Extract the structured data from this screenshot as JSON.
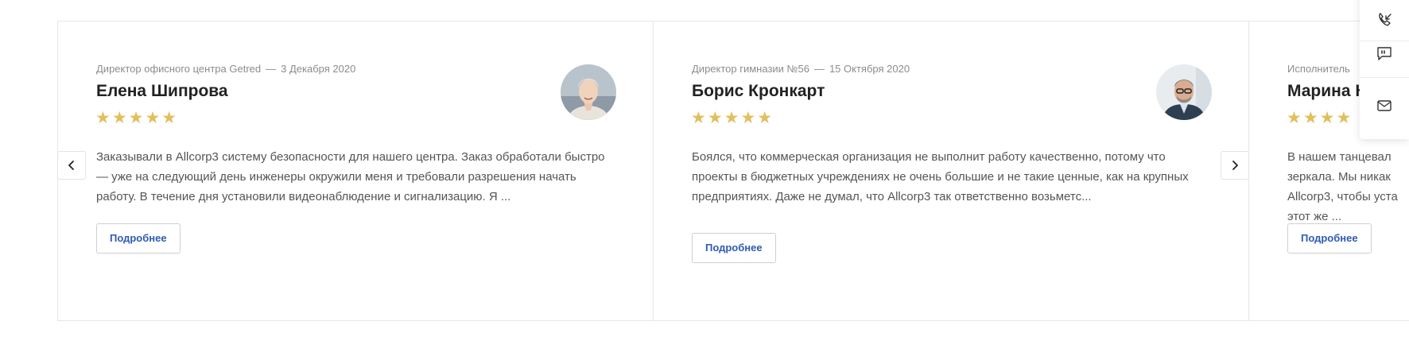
{
  "colors": {
    "star": "#e2bf5d",
    "button_text": "#2f5bb3",
    "meta_text": "#8c8c8c",
    "card_border": "#e6e6e6"
  },
  "slider": {
    "prev_icon": "chevron-left-icon",
    "next_icon": "chevron-right-icon"
  },
  "reviews": [
    {
      "position": "Директор офисного центра Getred",
      "date": "3 Декабря 2020",
      "separator": "—",
      "name": "Елена Шипрова",
      "stars": "★★★★★",
      "rating": 5,
      "text": "Заказывали в Allcorp3 систему безопасности для нашего центра. Заказ обработали быстро — уже на следующий день инженеры окружили меня и требовали разрешения начать работу. В течение дня установили видеонаблюдение и сигнализацию. Я ...",
      "button": "Подробнее"
    },
    {
      "position": "Директор гимназии №56",
      "date": "15 Октября 2020",
      "separator": "—",
      "name": "Борис Кронкарт",
      "stars": "★★★★★",
      "rating": 5,
      "text": "Боялся, что коммерческая организация не выполнит работу качественно, потому что проекты в бюджетных учреждениях не очень большие и не такие ценные, как на крупных предприятиях. Даже не думал, что Allcorp3 так ответственно возьметс...",
      "button": "Подробнее"
    },
    {
      "position": "Исполнитель",
      "date": "",
      "separator": "",
      "name": "Марина К",
      "stars": "★★★★",
      "rating": 4,
      "text": "В нашем танцевал зеркала. Мы никак Allcorp3, чтобы уста этот же ...",
      "button": "Подробнее"
    }
  ],
  "side_panel": {
    "items": [
      "phone-callback-icon",
      "chat-quote-icon",
      "mail-icon"
    ]
  }
}
